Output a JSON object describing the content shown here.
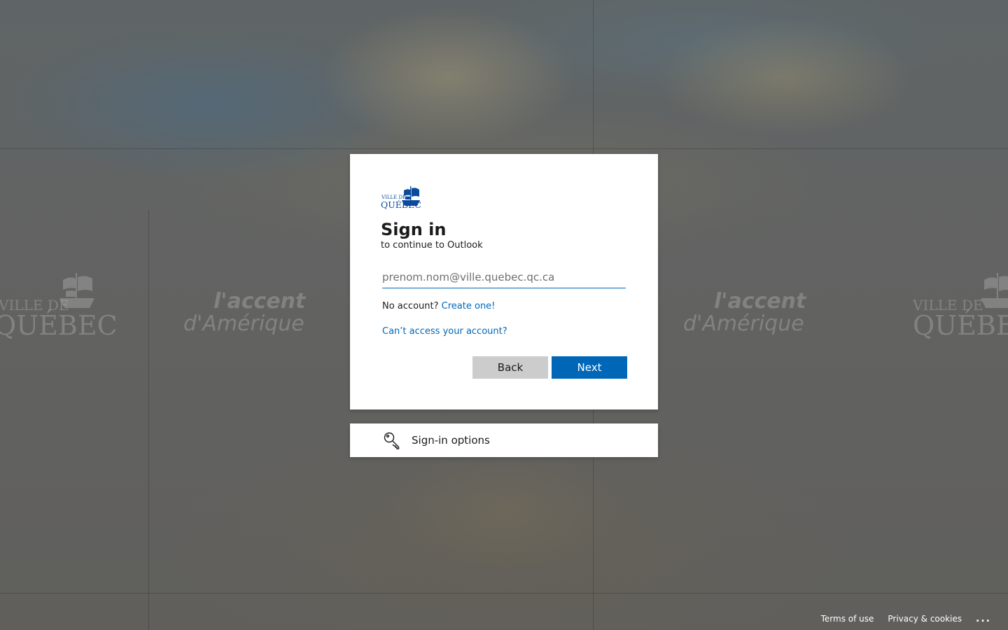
{
  "card": {
    "logo_text_top": "VILLE DE",
    "logo_text_bottom": "QUÉBEC",
    "title": "Sign in",
    "subtitle": "to continue to Outlook",
    "email_placeholder": "prenom.nom@ville.quebec.qc.ca",
    "email_value": "",
    "no_account_text": "No account?",
    "create_link": "Create one!",
    "cant_access_link": "Can’t access your account?",
    "back_label": "Back",
    "next_label": "Next"
  },
  "options": {
    "label": "Sign-in options",
    "icon": "key-icon"
  },
  "footer": {
    "terms": "Terms of use",
    "privacy": "Privacy & cookies",
    "more": "..."
  },
  "background": {
    "banner_city_top": "VILLE DE",
    "banner_city_bottom": "QUÉBEC",
    "banner_slogan_top": "l'accent",
    "banner_slogan_bottom": "d'Amérique"
  },
  "colors": {
    "accent": "#0067b8",
    "back_button": "#cccccc",
    "page_background": "#5f6160"
  }
}
